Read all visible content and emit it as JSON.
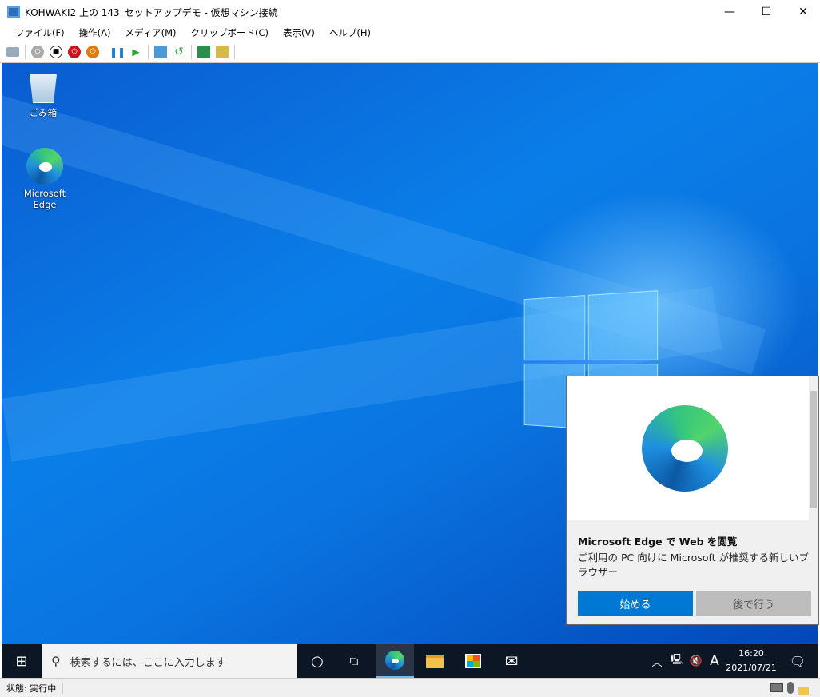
{
  "window": {
    "title": "KOHWAKI2 上の 143_セットアップデモ - 仮想マシン接続",
    "minimize": "—",
    "maximize": "☐",
    "close": "✕"
  },
  "menu": [
    "ファイル(F)",
    "操作(A)",
    "メディア(M)",
    "クリップボード(C)",
    "表示(V)",
    "ヘルプ(H)"
  ],
  "desktop": {
    "icons": [
      {
        "label": "ごみ箱"
      },
      {
        "label": "Microsoft Edge"
      }
    ]
  },
  "popup": {
    "heading": "Microsoft Edge で Web を閲覧",
    "body": "ご利用の PC 向けに Microsoft が推奨する新しいブラウザー",
    "primary": "始める",
    "secondary": "後で行う",
    "primary_color": "#0078d4",
    "secondary_color": "#bdbdbd"
  },
  "taskbar": {
    "search_placeholder": "検索するには、ここに入力します",
    "ime": "A",
    "time": "16:20",
    "date": "2021/07/21"
  },
  "status": {
    "text": "状態: 実行中"
  }
}
